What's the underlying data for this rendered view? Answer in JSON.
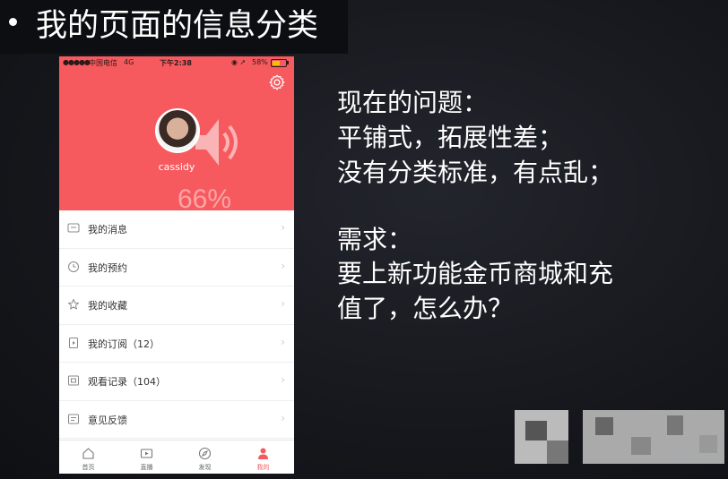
{
  "slide": {
    "title": "我的页面的信息分类"
  },
  "phone": {
    "status": {
      "dots": "●●●●●",
      "carrier": "中国电信",
      "network": "4G",
      "time": "下午2:38",
      "icons": "◉ ➚",
      "battery_text": "58%",
      "battery_level": 0.58
    },
    "username": "cassidy",
    "progress_text": "66%",
    "menu": [
      {
        "label": "我的消息",
        "icon": "message-icon"
      },
      {
        "label": "我的预约",
        "icon": "clock-icon"
      },
      {
        "label": "我的收藏",
        "icon": "star-icon"
      },
      {
        "label": "我的订阅（12）",
        "icon": "subscription-icon"
      },
      {
        "label": "观看记录（104）",
        "icon": "history-icon"
      },
      {
        "label": "意见反馈",
        "icon": "feedback-icon"
      }
    ],
    "arrow": "›",
    "tabs": [
      {
        "label": "首页",
        "icon": "home-icon"
      },
      {
        "label": "直播",
        "icon": "live-icon"
      },
      {
        "label": "发现",
        "icon": "compass-icon"
      },
      {
        "label": "我的",
        "icon": "person-icon",
        "active": true
      }
    ],
    "colors": {
      "accent": "#f65a5e"
    }
  },
  "notes": {
    "problem_heading": "现在的问题：",
    "problem_1": "平铺式，拓展性差；",
    "problem_2": "没有分类标准，有点乱；",
    "need_heading": "需求：",
    "need_1": "要上新功能金币商城和充",
    "need_2": "值了，怎么办？"
  }
}
